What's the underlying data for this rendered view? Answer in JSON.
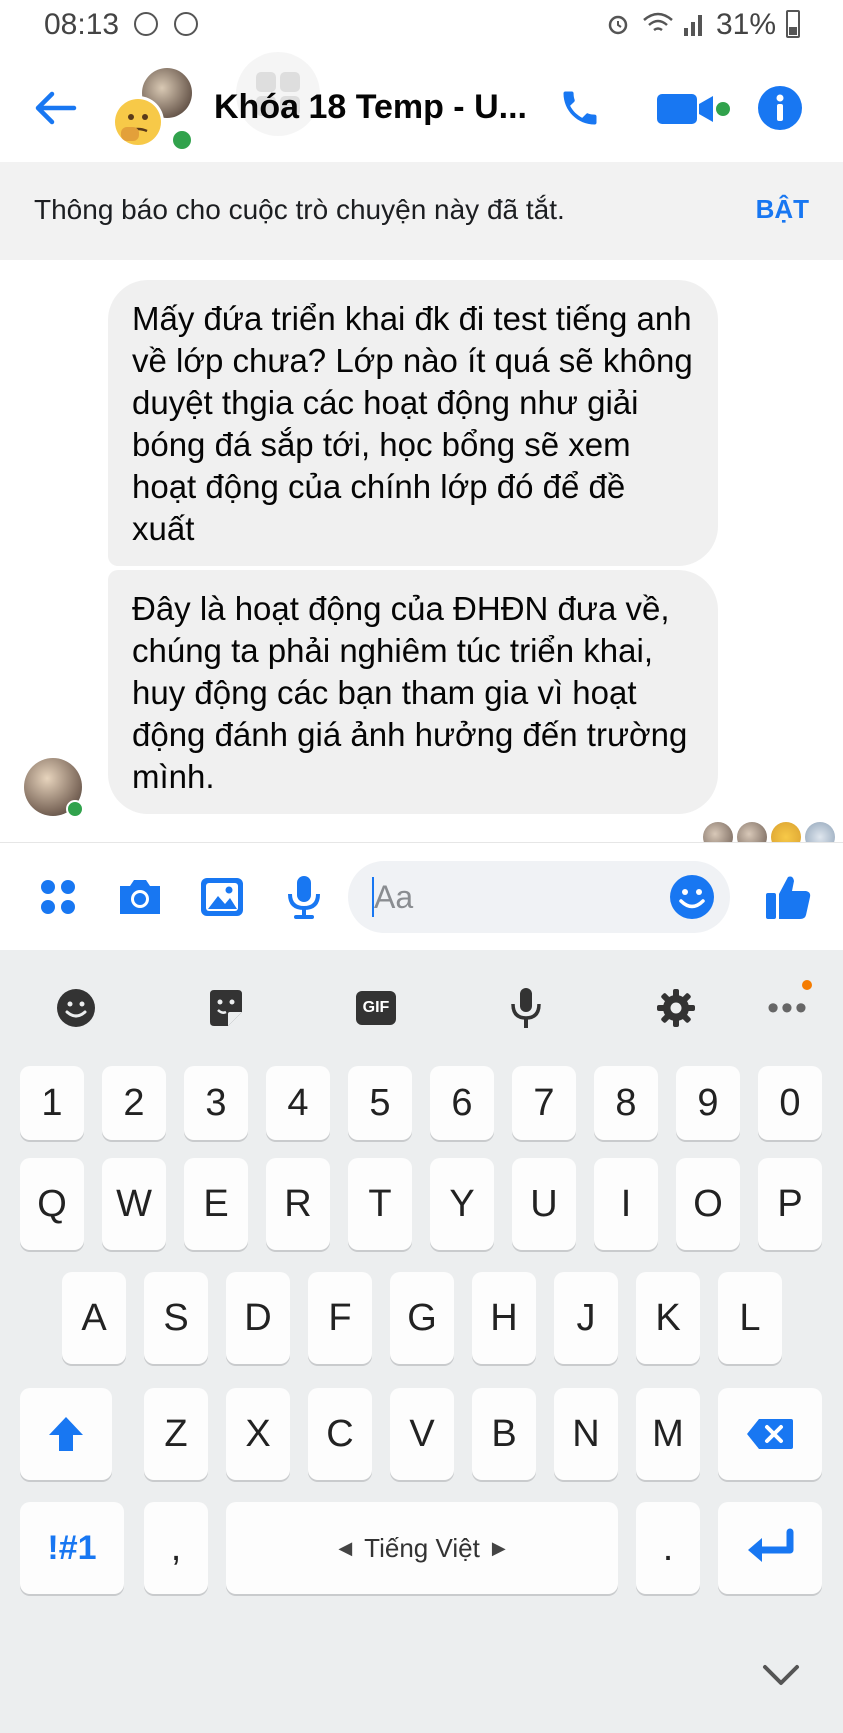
{
  "status_bar": {
    "time": "08:13",
    "battery": "31%"
  },
  "header": {
    "title": "Khóa 18 Temp - U..."
  },
  "notice": {
    "text": "Thông báo cho cuộc trò chuyện này đã tắt.",
    "action": "BẬT"
  },
  "messages": [
    {
      "text": "Mấy đứa triển khai đk đi test tiếng anh về lớp chưa? Lớp nào ít quá sẽ không duyệt thgia các hoạt động như giải bóng đá sắp tới, học bổng sẽ xem hoạt động của chính lớp đó để đề xuất"
    },
    {
      "text": "Đây là hoạt động của ĐHĐN đưa về, chúng ta phải nghiêm túc triển khai, huy động các bạn tham gia vì hoạt động đánh giá ảnh hưởng đến trường mình."
    }
  ],
  "composer": {
    "placeholder": "Aa"
  },
  "keyboard": {
    "row_numbers": [
      "1",
      "2",
      "3",
      "4",
      "5",
      "6",
      "7",
      "8",
      "9",
      "0"
    ],
    "row_1": [
      "Q",
      "W",
      "E",
      "R",
      "T",
      "Y",
      "U",
      "I",
      "O",
      "P"
    ],
    "row_2": [
      "A",
      "S",
      "D",
      "F",
      "G",
      "H",
      "J",
      "K",
      "L"
    ],
    "row_3": [
      "Z",
      "X",
      "C",
      "V",
      "B",
      "N",
      "M"
    ],
    "symbols_key": "!#1",
    "comma_key": ",",
    "space_label": "Tiếng Việt",
    "period_key": ".",
    "gif_label": "GIF"
  },
  "colors": {
    "accent": "#1877f2",
    "online": "#31a24c",
    "bubble": "#f0f0f0",
    "keyboard_bg": "#eceeef"
  },
  "icons": {
    "header": [
      "back-arrow-icon",
      "phone-icon",
      "video-camera-icon",
      "info-icon"
    ],
    "composer": [
      "menu-grid-icon",
      "camera-icon",
      "gallery-icon",
      "microphone-icon",
      "emoji-icon",
      "thumbs-up-icon"
    ],
    "keyboard_toolbar": [
      "emoji-icon",
      "sticker-icon",
      "gif-icon",
      "microphone-icon",
      "settings-gear-icon",
      "more-icon"
    ]
  }
}
